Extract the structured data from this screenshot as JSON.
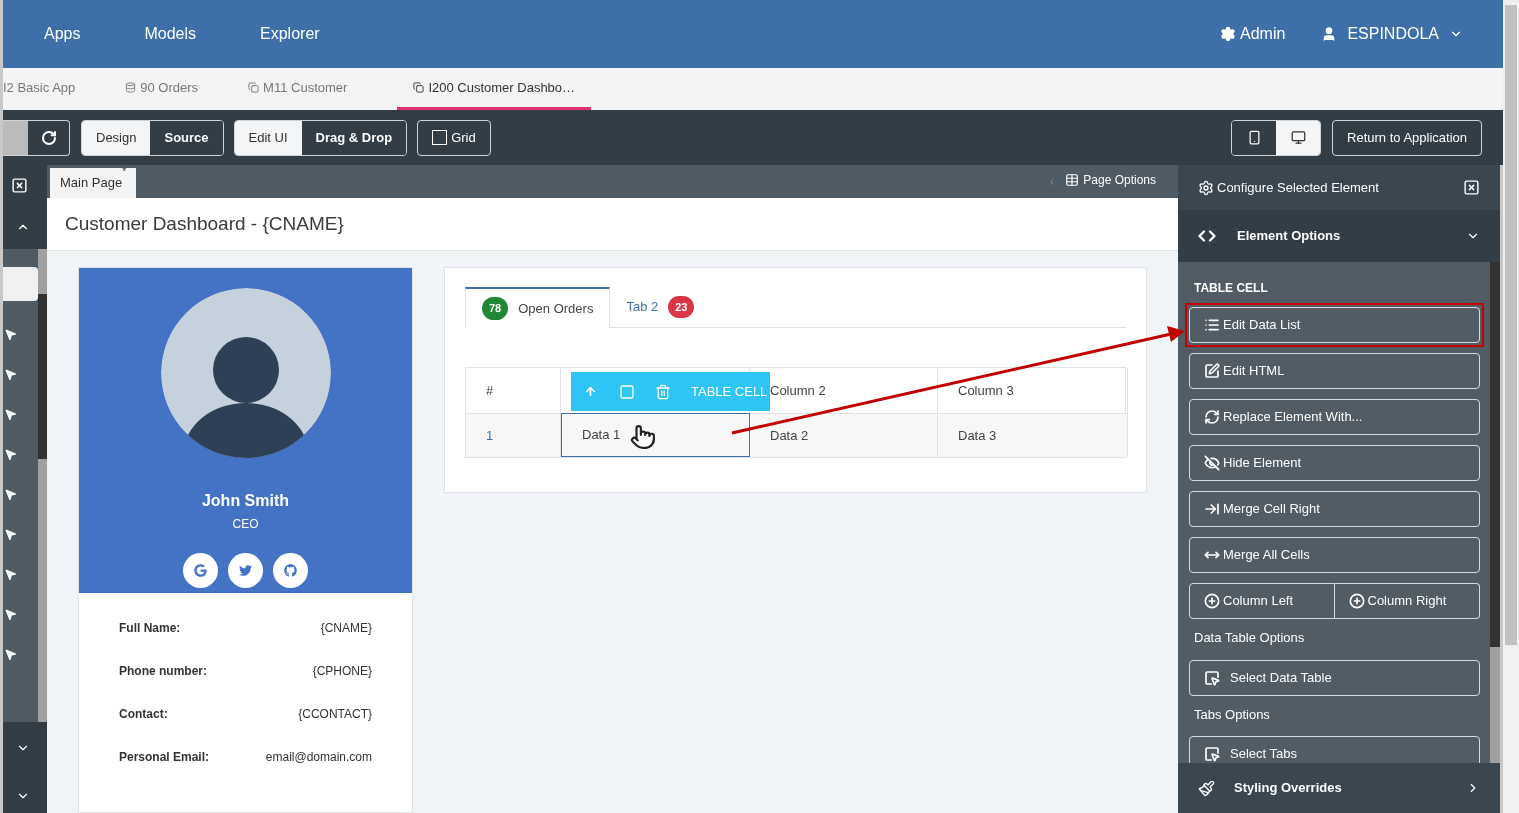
{
  "nav": {
    "items": [
      "Apps",
      "Models",
      "Explorer"
    ],
    "admin": "Admin",
    "user": "ESPINDOLA"
  },
  "app_tabs": [
    {
      "label": "I2 Basic App",
      "kind": "plain",
      "selected": false
    },
    {
      "label": "90 Orders",
      "kind": "database",
      "selected": false
    },
    {
      "label": "M11 Customer",
      "kind": "page",
      "selected": false
    },
    {
      "label": "I200 Customer Dashbo…",
      "kind": "page",
      "selected": true
    }
  ],
  "toolbar": {
    "view_toggle": [
      {
        "label": "Design",
        "selected": false
      },
      {
        "label": "Source",
        "selected": true
      }
    ],
    "edit_toggle": [
      {
        "label": "Edit UI",
        "selected": false
      },
      {
        "label": "Drag & Drop",
        "selected": true
      }
    ],
    "grid": {
      "label": "Grid",
      "checked": false
    },
    "device_toggle": [
      {
        "kind": "mobile",
        "selected": true
      },
      {
        "kind": "desktop",
        "selected": false
      }
    ],
    "return_button": "Return to Application"
  },
  "page_tab": {
    "label": "Main Page",
    "modified_mark": "*",
    "options": "Page Options"
  },
  "page_title": "Customer Dashboard - {CNAME}",
  "profile": {
    "name": "John Smith",
    "role": "CEO",
    "social": [
      {
        "kind": "google"
      },
      {
        "kind": "twitter"
      },
      {
        "kind": "github"
      }
    ],
    "fields": [
      {
        "label": "Full Name:",
        "value": "{CNAME}"
      },
      {
        "label": "Phone number:",
        "value": "{CPHONE}"
      },
      {
        "label": "Contact:",
        "value": "{CCONTACT}"
      },
      {
        "label": "Personal Email:",
        "value": "email@domain.com"
      }
    ]
  },
  "orders": {
    "tabs": [
      {
        "label": "Open Orders",
        "badge": "78",
        "color": "#218838",
        "selected": true
      },
      {
        "label": "Tab 2",
        "badge": "23",
        "color": "#dc3545",
        "selected": false
      }
    ],
    "cell_toolbar": "TABLE CELL",
    "columns": [
      {
        "label": "#",
        "covered": false
      },
      {
        "covered": true
      },
      {
        "label": "Column 2",
        "covered": false
      },
      {
        "label": "Column 3",
        "covered": false
      }
    ],
    "rows": [
      [
        {
          "text": "1",
          "selected": false
        },
        {
          "text": "Data 1",
          "selected": true
        },
        {
          "text": "Data 2",
          "selected": false
        },
        {
          "text": "Data 3",
          "selected": false
        }
      ]
    ]
  },
  "panel": {
    "title": "Configure Selected Element",
    "section": "Element Options",
    "footer": "Styling Overrides",
    "groups": [
      {
        "heading": "TABLE CELL",
        "kind": "caps",
        "rows": [
          [
            {
              "label": "Edit Data List",
              "highlighted": true
            }
          ],
          [
            {
              "label": "Edit HTML",
              "highlighted": false
            }
          ],
          [
            {
              "label": "Replace Element With...",
              "highlighted": false
            }
          ],
          [
            {
              "label": "Hide Element",
              "highlighted": false
            }
          ],
          [
            {
              "label": "Merge Cell Right",
              "highlighted": false
            }
          ],
          [
            {
              "label": "Merge All Cells",
              "highlighted": false
            }
          ],
          [
            {
              "label": "Column Left",
              "highlighted": false
            },
            {
              "label": "Column Right",
              "highlighted": false
            }
          ]
        ]
      },
      {
        "heading": "Data Table Options",
        "kind": "plain",
        "rows": [
          [
            {
              "label": "Select Data Table",
              "highlighted": false
            }
          ]
        ]
      },
      {
        "heading": "Tabs Options",
        "kind": "plain",
        "rows": [
          [
            {
              "label": "Select Tabs",
              "highlighted": false
            }
          ]
        ]
      }
    ]
  }
}
